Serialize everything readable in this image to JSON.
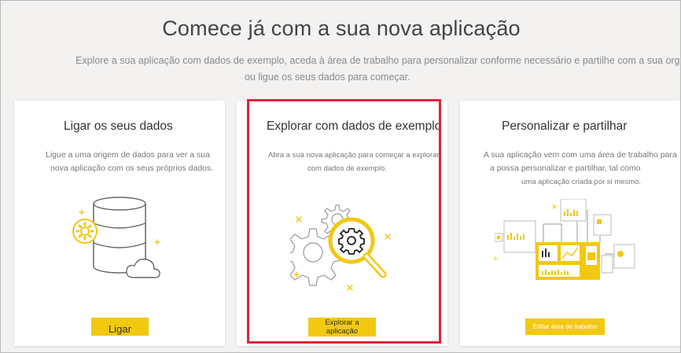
{
  "header": {
    "title": "Comece já com a sua nova aplicação",
    "subtitle_line1": "Explore a sua aplicação com dados de exemplo, aceda à área de trabalho para personalizar conforme necessário e partilhe com a sua org",
    "subtitle_line2": "ou ligue os seus dados para começar."
  },
  "cards": [
    {
      "title": "Ligar os seus dados",
      "desc_line1": "Ligue a uma origem de dados para ver a sua",
      "desc_line2": "nova aplicação com os seus próprios dados.",
      "button": "Ligar",
      "icon": "database-cloud-icon"
    },
    {
      "title": "Explorar com dados de exemplo",
      "desc_line1": "Abra a sua nova aplicação para começar a explorar",
      "desc_line2": "com dados de exemplo.",
      "button": "Explorar a aplicação",
      "icon": "gears-magnifier-icon"
    },
    {
      "title": "Personalizar e partilhar",
      "desc_line1": "A sua aplicação vem com uma área de trabalho para",
      "desc_line2": "a possa personalizar e partilhar, tal como",
      "desc_line3": "uma aplicação criada por si mesmo.",
      "button": "Editar área de trabalho",
      "icon": "dashboard-icon"
    }
  ],
  "colors": {
    "accent": "#f2c811",
    "highlight": "#e0233a"
  }
}
